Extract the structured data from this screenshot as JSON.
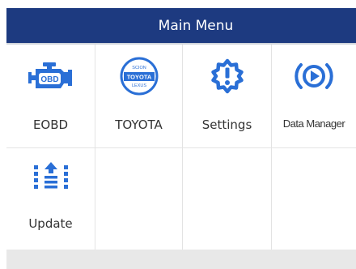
{
  "header": {
    "title": "Main Menu"
  },
  "menu": {
    "items": [
      {
        "label": "EOBD",
        "icon": "engine-obd-icon"
      },
      {
        "label": "TOYOTA",
        "icon": "toyota-logo-icon",
        "logo_text": [
          "SCION",
          "TOYOTA",
          "LEXUS"
        ]
      },
      {
        "label": "Settings",
        "icon": "gear-icon"
      },
      {
        "label": "Data Manager",
        "icon": "play-icon"
      },
      {
        "label": "Update",
        "icon": "update-icon"
      }
    ]
  },
  "colors": {
    "header_bg": "#1d3a80",
    "icon_blue": "#2a6fd6",
    "footer_bg": "#e8e8e8"
  }
}
